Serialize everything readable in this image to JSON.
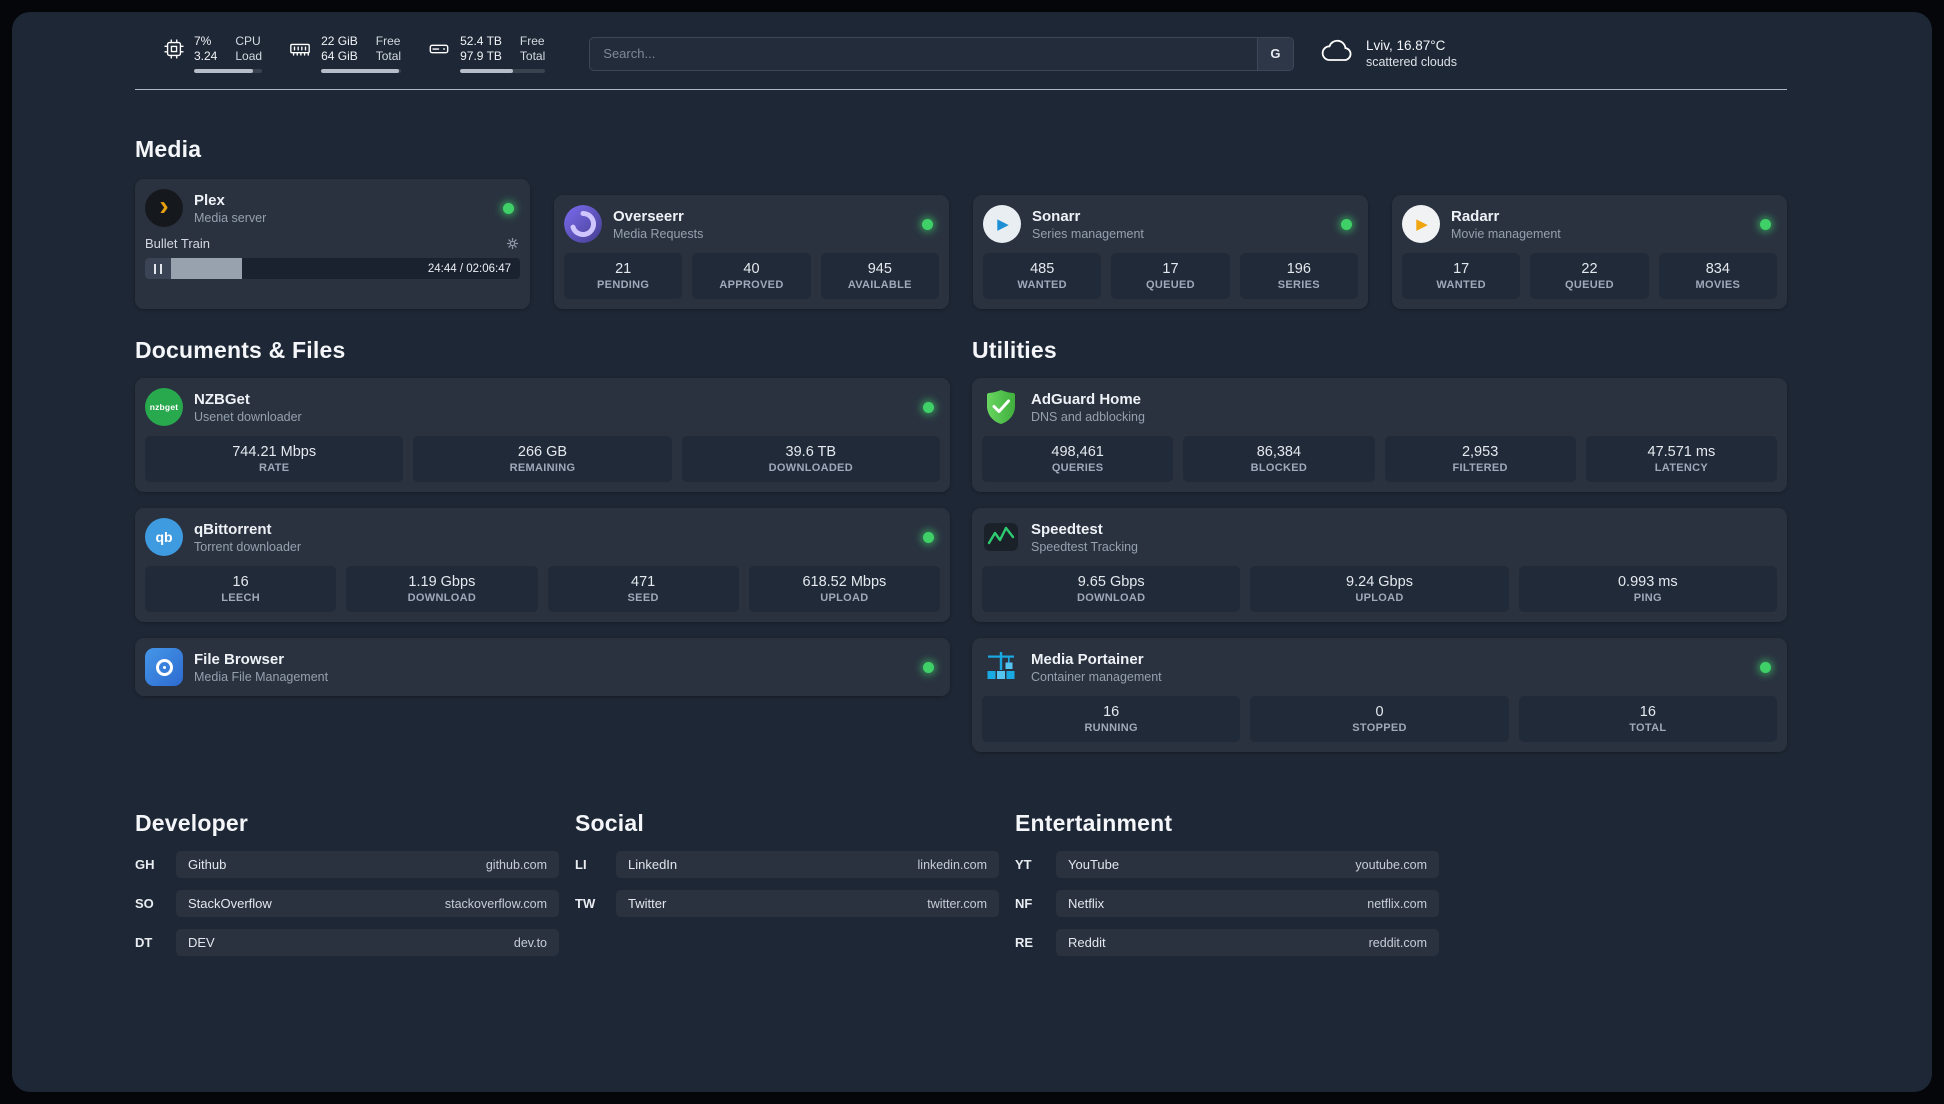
{
  "topbar": {
    "cpu": {
      "value_top": "7%",
      "value_bottom": "3.24",
      "label_top": "CPU",
      "label_bottom": "Load",
      "bar_percent": 86
    },
    "ram": {
      "value_top": "22 GiB",
      "value_bottom": "64 GiB",
      "label_top": "Free",
      "label_bottom": "Total",
      "bar_percent": 97
    },
    "disk": {
      "value_top": "52.4 TB",
      "value_bottom": "97.9 TB",
      "label_top": "Free",
      "label_bottom": "Total",
      "bar_percent": 62
    },
    "search": {
      "placeholder": "Search...",
      "engine_button": "G"
    },
    "weather": {
      "location": "Lviv, 16.87°C",
      "condition": "scattered clouds"
    }
  },
  "media": {
    "title": "Media",
    "plex": {
      "name": "Plex",
      "desc": "Media server",
      "player": {
        "title": "Bullet Train",
        "time": "24:44 / 02:06:47",
        "progress_percent": 19
      }
    },
    "overseerr": {
      "name": "Overseerr",
      "desc": "Media Requests",
      "stats": [
        {
          "value": "21",
          "label": "PENDING"
        },
        {
          "value": "40",
          "label": "APPROVED"
        },
        {
          "value": "945",
          "label": "AVAILABLE"
        }
      ]
    },
    "sonarr": {
      "name": "Sonarr",
      "desc": "Series management",
      "stats": [
        {
          "value": "485",
          "label": "WANTED"
        },
        {
          "value": "17",
          "label": "QUEUED"
        },
        {
          "value": "196",
          "label": "SERIES"
        }
      ]
    },
    "radarr": {
      "name": "Radarr",
      "desc": "Movie management",
      "stats": [
        {
          "value": "17",
          "label": "WANTED"
        },
        {
          "value": "22",
          "label": "QUEUED"
        },
        {
          "value": "834",
          "label": "MOVIES"
        }
      ]
    }
  },
  "documents": {
    "title": "Documents & Files",
    "nzbget": {
      "name": "NZBGet",
      "desc": "Usenet downloader",
      "icon_text": "nzbget",
      "stats": [
        {
          "value": "744.21 Mbps",
          "label": "RATE"
        },
        {
          "value": "266 GB",
          "label": "REMAINING"
        },
        {
          "value": "39.6 TB",
          "label": "DOWNLOADED"
        }
      ]
    },
    "qbittorrent": {
      "name": "qBittorrent",
      "desc": "Torrent downloader",
      "icon_text": "qb",
      "stats": [
        {
          "value": "16",
          "label": "LEECH"
        },
        {
          "value": "1.19 Gbps",
          "label": "DOWNLOAD"
        },
        {
          "value": "471",
          "label": "SEED"
        },
        {
          "value": "618.52 Mbps",
          "label": "UPLOAD"
        }
      ]
    },
    "filebrowser": {
      "name": "File Browser",
      "desc": "Media File Management"
    }
  },
  "utilities": {
    "title": "Utilities",
    "adguard": {
      "name": "AdGuard Home",
      "desc": "DNS and adblocking",
      "stats": [
        {
          "value": "498,461",
          "label": "QUERIES"
        },
        {
          "value": "86,384",
          "label": "BLOCKED"
        },
        {
          "value": "2,953",
          "label": "FILTERED"
        },
        {
          "value": "47.571 ms",
          "label": "LATENCY"
        }
      ]
    },
    "speedtest": {
      "name": "Speedtest",
      "desc": "Speedtest Tracking",
      "stats": [
        {
          "value": "9.65 Gbps",
          "label": "DOWNLOAD"
        },
        {
          "value": "9.24 Gbps",
          "label": "UPLOAD"
        },
        {
          "value": "0.993 ms",
          "label": "PING"
        }
      ]
    },
    "portainer": {
      "name": "Media Portainer",
      "desc": "Container management",
      "stats": [
        {
          "value": "16",
          "label": "RUNNING"
        },
        {
          "value": "0",
          "label": "STOPPED"
        },
        {
          "value": "16",
          "label": "TOTAL"
        }
      ]
    }
  },
  "bookmarks": {
    "developer": {
      "title": "Developer",
      "items": [
        {
          "abbr": "GH",
          "name": "Github",
          "url": "github.com"
        },
        {
          "abbr": "SO",
          "name": "StackOverflow",
          "url": "stackoverflow.com"
        },
        {
          "abbr": "DT",
          "name": "DEV",
          "url": "dev.to"
        }
      ]
    },
    "social": {
      "title": "Social",
      "items": [
        {
          "abbr": "LI",
          "name": "LinkedIn",
          "url": "linkedin.com"
        },
        {
          "abbr": "TW",
          "name": "Twitter",
          "url": "twitter.com"
        }
      ]
    },
    "entertainment": {
      "title": "Entertainment",
      "items": [
        {
          "abbr": "YT",
          "name": "YouTube",
          "url": "youtube.com"
        },
        {
          "abbr": "NF",
          "name": "Netflix",
          "url": "netflix.com"
        },
        {
          "abbr": "RE",
          "name": "Reddit",
          "url": "reddit.com"
        }
      ]
    }
  }
}
